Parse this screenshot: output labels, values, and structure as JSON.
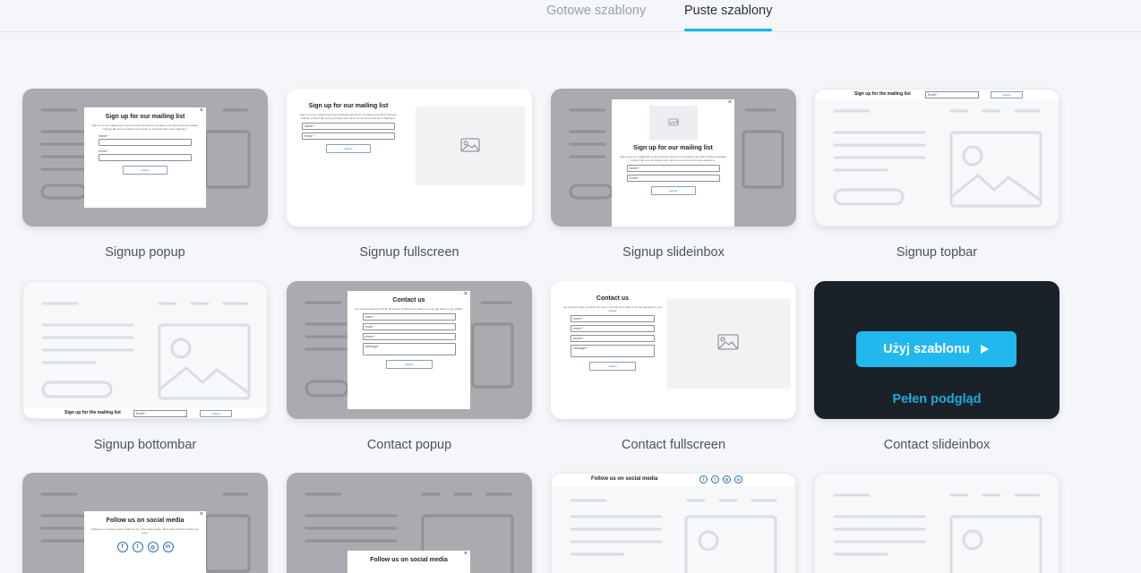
{
  "tabs": [
    {
      "label": "Gotowe szablony",
      "active": false
    },
    {
      "label": "Puste szablony",
      "active": true
    }
  ],
  "templates": [
    {
      "caption": "Signup popup"
    },
    {
      "caption": "Signup fullscreen"
    },
    {
      "caption": "Signup slideinbox"
    },
    {
      "caption": "Signup topbar"
    },
    {
      "caption": "Signup bottombar"
    },
    {
      "caption": "Contact popup"
    },
    {
      "caption": "Contact fullscreen"
    },
    {
      "caption": "Contact slideinbox"
    }
  ],
  "hover": {
    "use_button": "Użyj szablonu",
    "preview_link": "Pełen podgląd",
    "accent": "#22b8ee"
  },
  "signup": {
    "title": "Sign up for our mailing list",
    "desc": "Sign up to our mailing list to get exclusive access to members-only offers and pre-release content. Be sure to include your name so we know who we're talking to.",
    "name_label": "Name *",
    "email_label": "Email *",
    "submit": "submit"
  },
  "topbar": {
    "title": "Sign up for the mailing list",
    "email_placeholder": "Email *",
    "submit": "submit"
  },
  "bottombar": {
    "title": "Sign up for the mailing list",
    "email_placeholder": "Email *",
    "submit": "submit"
  },
  "contact": {
    "title": "Contact us",
    "desc": "Let us know what you think, be sure to include an e-mail so we can get back to you quickly.",
    "name": "name *",
    "email": "email *",
    "phone": "phone *",
    "message": "message *",
    "submit": "submit"
  },
  "social": {
    "title": "Follow us on social media",
    "desc": "Follow us on social media to stay on top of the latest news, offers and promotions from our team.",
    "icons": [
      "facebook-icon",
      "twitter-icon",
      "instagram-icon",
      "linkedin-icon"
    ]
  }
}
